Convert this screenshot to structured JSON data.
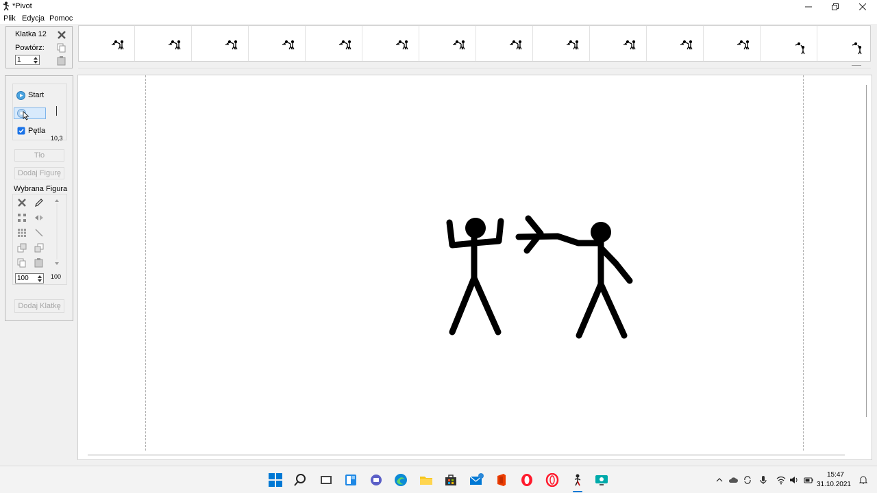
{
  "window": {
    "title": "*Pivot",
    "icon": "pivot-stickman-icon"
  },
  "menu": {
    "items": [
      "Plik",
      "Edycja",
      "Pomoc"
    ]
  },
  "frame_panel": {
    "frame_label": "Klatka 12",
    "repeat_label": "Powtórz:",
    "repeat_value": "1"
  },
  "playback": {
    "start_label": "Start",
    "loop_label": "Pętla",
    "loop_checked": true,
    "speed_value": "10,3"
  },
  "left_panel": {
    "background_label": "Tło",
    "add_figure_label": "Dodaj Figurę",
    "selected_figure_label": "Wybrana Figura",
    "scale_value": "100",
    "opacity_value": "100",
    "add_frame_label": "Dodaj Klatkę"
  },
  "filmstrip": {
    "frame_count": 14
  },
  "tray": {
    "time": "15:47",
    "date": "31.10.2021"
  },
  "colors": {
    "accent": "#0078d4",
    "selected_checkbox": "#1a73e8"
  }
}
